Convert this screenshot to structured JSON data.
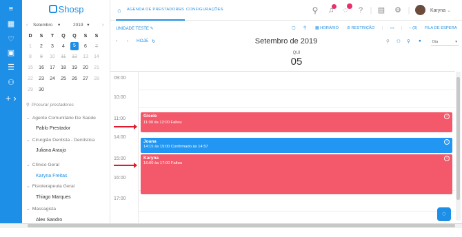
{
  "rail": {
    "icons": [
      "menu-icon",
      "calendar-icon",
      "heart-icon",
      "money-icon",
      "list-icon",
      "handshake-icon",
      "plus-icon"
    ]
  },
  "brand": {
    "name": "Shosp"
  },
  "mini_calendar": {
    "month": "Setembro",
    "year": "2019",
    "weekdays": [
      "D",
      "S",
      "T",
      "Q",
      "Q",
      "S",
      "S"
    ],
    "weeks": [
      [
        "1",
        "2",
        "3",
        "4",
        "5",
        "6",
        "7"
      ],
      [
        "8",
        "9",
        "10",
        "11",
        "12",
        "13",
        "14"
      ],
      [
        "15",
        "16",
        "17",
        "18",
        "19",
        "20",
        "21"
      ],
      [
        "22",
        "23",
        "24",
        "25",
        "26",
        "27",
        "28"
      ],
      [
        "29",
        "30"
      ]
    ],
    "selected_day": "5"
  },
  "search": {
    "placeholder": "Procurar prestadores"
  },
  "groups": [
    {
      "label": "Agente Comunitário De Saúde",
      "providers": [
        "Pablo Prestador"
      ]
    },
    {
      "label": "Cirurgião Dentista - Dentística",
      "providers": [
        "Juliana Araujo"
      ]
    },
    {
      "label": "Clínico Geral",
      "providers": [
        "Karyna Freitas"
      ]
    },
    {
      "label": "Fisioterapeuta Geral",
      "providers": [
        "Thiago Marques"
      ]
    },
    {
      "label": "Massagista",
      "providers": [
        "Alex Sandro"
      ]
    }
  ],
  "active_provider": "Karyna Freitas",
  "topbar": {
    "tabs": [
      "AGENDA DE PRESTADORES",
      "CONFIGURAÇÕES"
    ],
    "user_name": "Karyna",
    "badge_color": "#e8306b"
  },
  "toolbar": {
    "unit": "UNIDADE TESTE",
    "horario": "HORÁRIO",
    "restricao": "RESTRIÇÃO",
    "fila_count": "(0)",
    "fila": "FILA DE ESPERA"
  },
  "nav": {
    "today": "HOJE",
    "title": "Setembro de 2019",
    "view": "Dia"
  },
  "day_header": {
    "weekday": "QUI",
    "day": "05"
  },
  "hours": [
    "09:00",
    "10:00",
    "11:00",
    "14:00",
    "15:00",
    "16:00",
    "17:00"
  ],
  "events": [
    {
      "name": "Gisele",
      "time": "11:00 às 12:00 Faltou",
      "color": "#f3596b"
    },
    {
      "name": "Joana",
      "time": "14:15 às 15:00 Confirmado às 14:57",
      "color": "#2196f3"
    },
    {
      "name": "Karyna",
      "time": "16:00 às 17:00 Faltou",
      "color": "#f3596b"
    }
  ],
  "colors": {
    "accent": "#1e8fe6",
    "missed": "#f3596b",
    "confirmed": "#2196f3"
  }
}
